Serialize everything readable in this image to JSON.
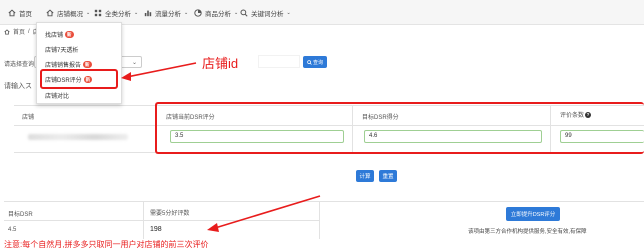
{
  "nav": {
    "items": [
      {
        "name": "nav-home",
        "icon": "home-icon",
        "label": "首页"
      },
      {
        "name": "nav-shop-overview",
        "icon": "home-icon",
        "label": "店铺概况"
      },
      {
        "name": "nav-category",
        "icon": "grid-icon",
        "label": "全类分析"
      },
      {
        "name": "nav-traffic",
        "icon": "bar-chart-icon",
        "label": "流量分析"
      },
      {
        "name": "nav-product",
        "icon": "pie-chart-icon",
        "label": "商品分析"
      },
      {
        "name": "nav-keyword",
        "icon": "search-icon",
        "label": "关键词分析"
      }
    ]
  },
  "breadcrumb": {
    "home": "首页",
    "separator": "/",
    "current": "店"
  },
  "menu": {
    "items": [
      {
        "label": "找店铺",
        "badge": "新"
      },
      {
        "label": "店铺7天透析",
        "badge": ""
      },
      {
        "label": "店铺销售报告",
        "badge": "新"
      },
      {
        "label": "店铺DSR评分",
        "badge": "新"
      },
      {
        "label": "店铺对比",
        "badge": ""
      }
    ]
  },
  "form": {
    "select_label": "请选择查询",
    "input_label": "请输入ス",
    "annotation": "店铺id",
    "query_button": "查询"
  },
  "table": {
    "shop_header": "店铺",
    "current_dsr_header": "店铺当前DSR评分",
    "target_dsr_header": "目标DSR得分",
    "review_count_header": "评价条数",
    "current_dsr_value": "3.5",
    "target_dsr_value": "4.6",
    "review_count_value": "99"
  },
  "buttons": {
    "calculate": "计算",
    "reset": "重置",
    "upgrade": "立即提升DSR评分"
  },
  "result": {
    "target_header": "目标DSR",
    "needed_header": "需要5分好评数",
    "target_value": "4.5",
    "needed_value": "198"
  },
  "description": "该项由第三方合作机构提供服务,安全有效,有保障",
  "note": "注意:每个自然月,拼多多只取同一用户对店铺的前三次评价",
  "colors": {
    "accent": "#2e7ad8",
    "highlight": "#e81c1c",
    "badge": "#e94e3c",
    "input_border": "#9fcf93"
  }
}
